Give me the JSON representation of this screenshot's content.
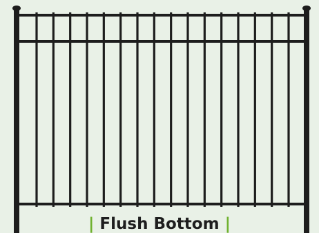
{
  "fence": {
    "style": "Flush Bottom",
    "picket_count": 16,
    "rail_count": 3,
    "post_count": 2,
    "color": "#1d1d1d",
    "accent_color": "#6fb12e",
    "background_color": "#e9f1e7"
  },
  "caption": {
    "left_mark": "|",
    "label": "Flush Bottom",
    "right_mark": "|"
  }
}
